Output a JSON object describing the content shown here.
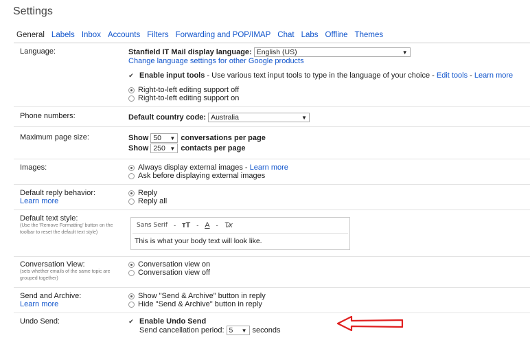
{
  "page_title": "Settings",
  "tabs": [
    "General",
    "Labels",
    "Inbox",
    "Accounts",
    "Filters",
    "Forwarding and POP/IMAP",
    "Chat",
    "Labs",
    "Offline",
    "Themes"
  ],
  "language": {
    "label": "Language:",
    "display_language_label": "Stanfield IT Mail display language:",
    "display_language_value": "English (US)",
    "change_link": "Change language settings for other Google products",
    "input_tools_label": "Enable input tools",
    "input_tools_desc": " - Use various text input tools to type in the language of your choice - ",
    "edit_tools_link": "Edit tools",
    "sep": " - ",
    "learn_more": "Learn more",
    "rtl_off": "Right-to-left editing support off",
    "rtl_on": "Right-to-left editing support on"
  },
  "phone": {
    "label": "Phone numbers:",
    "country_label": "Default country code:",
    "country_value": "Australia"
  },
  "page_size": {
    "label": "Maximum page size:",
    "show": "Show",
    "conv_value": "50",
    "conv_suffix": "conversations per page",
    "contacts_value": "250",
    "contacts_suffix": "contacts per page"
  },
  "images": {
    "label": "Images:",
    "always": "Always display external images",
    "sep": " - ",
    "learn_more": "Learn more",
    "ask": "Ask before displaying external images"
  },
  "reply": {
    "label": "Default reply behavior:",
    "learn_more": "Learn more",
    "reply": "Reply",
    "reply_all": "Reply all"
  },
  "text_style": {
    "label": "Default text style:",
    "sub": "(Use the 'Remove Formatting' button on the toolbar to reset the default text style)",
    "font": "Sans Serif",
    "preview": "This is what your body text will look like."
  },
  "conversation": {
    "label": "Conversation View:",
    "sub": "(sets whether emails of the same topic are grouped together)",
    "on": "Conversation view on",
    "off": "Conversation view off"
  },
  "send_archive": {
    "label": "Send and Archive:",
    "learn_more": "Learn more",
    "show": "Show \"Send & Archive\" button in reply",
    "hide": "Hide \"Send & Archive\" button in reply"
  },
  "undo": {
    "label": "Undo Send:",
    "enable": "Enable Undo Send",
    "period_label": "Send cancellation period:",
    "period_value": "5",
    "seconds": "seconds"
  },
  "colors": {
    "link": "#1155cc",
    "arrow": "#e02020"
  }
}
